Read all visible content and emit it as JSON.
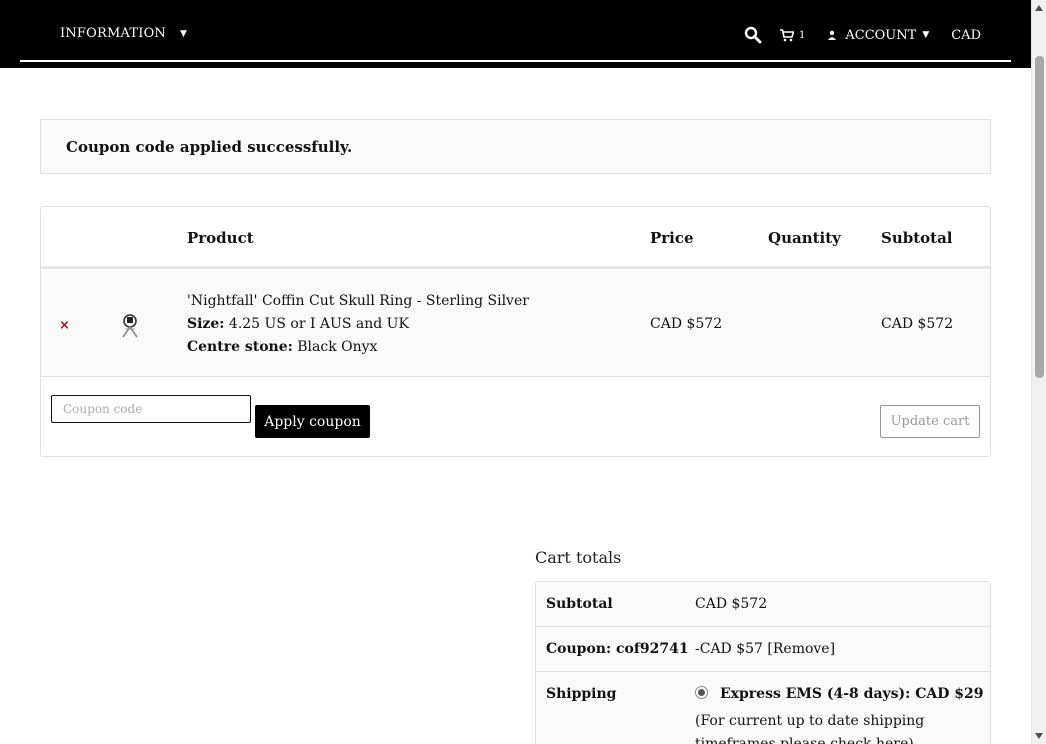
{
  "header": {
    "info_label": "INFORMATION",
    "cart_count": "1",
    "account_label": "ACCOUNT",
    "currency": "CAD"
  },
  "notice": {
    "message": "Coupon code applied successfully."
  },
  "cart": {
    "columns": {
      "product": "Product",
      "price": "Price",
      "quantity": "Quantity",
      "subtotal": "Subtotal"
    },
    "items": [
      {
        "remove": "×",
        "name": "'Nightfall' Coffin Cut Skull Ring - Sterling Silver",
        "size_label": "Size:",
        "size_value": "4.25 US or I AUS and UK",
        "stone_label": "Centre stone:",
        "stone_value": "Black Onyx",
        "price": "CAD $572",
        "subtotal": "CAD $572"
      }
    ],
    "coupon_placeholder": "Coupon code",
    "apply_label": "Apply coupon",
    "update_label": "Update cart"
  },
  "totals": {
    "title": "Cart totals",
    "subtotal_label": "Subtotal",
    "subtotal_value": "CAD $572",
    "coupon_label": "Coupon: cof92741",
    "coupon_value": "-CAD $57",
    "coupon_remove": "[Remove]",
    "shipping_label": "Shipping",
    "shipping_option": "Express EMS (4-8 days): CAD $29",
    "shipping_note": "(For current up to date shipping timeframes please check here)"
  },
  "icons": {
    "search": "search-icon",
    "cart": "cart-icon",
    "user": "user-icon",
    "caret": "caret-down-icon"
  }
}
